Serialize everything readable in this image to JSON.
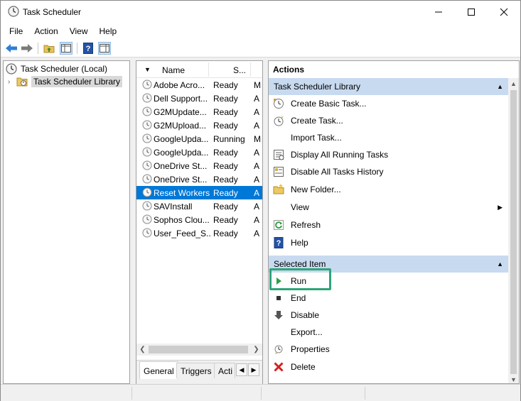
{
  "window": {
    "title": "Task Scheduler"
  },
  "menu": [
    "File",
    "Action",
    "View",
    "Help"
  ],
  "tree": {
    "root": "Task Scheduler (Local)",
    "library": "Task Scheduler Library"
  },
  "list": {
    "col_name": "Name",
    "col_status": "S...",
    "rows": [
      {
        "name": "Adobe Acro...",
        "status": "Ready",
        "trig": "M"
      },
      {
        "name": "Dell Support...",
        "status": "Ready",
        "trig": "A"
      },
      {
        "name": "G2MUpdate...",
        "status": "Ready",
        "trig": "A"
      },
      {
        "name": "G2MUpload...",
        "status": "Ready",
        "trig": "A"
      },
      {
        "name": "GoogleUpda...",
        "status": "Running",
        "trig": "M"
      },
      {
        "name": "GoogleUpda...",
        "status": "Ready",
        "trig": "A"
      },
      {
        "name": "OneDrive St...",
        "status": "Ready",
        "trig": "A"
      },
      {
        "name": "OneDrive St...",
        "status": "Ready",
        "trig": "A"
      },
      {
        "name": "Reset Workers",
        "status": "Ready",
        "trig": "A"
      },
      {
        "name": "SAVInstall",
        "status": "Ready",
        "trig": "A"
      },
      {
        "name": "Sophos Clou...",
        "status": "Ready",
        "trig": "A"
      },
      {
        "name": "User_Feed_S...",
        "status": "Ready",
        "trig": "A"
      }
    ],
    "selected_index": 8,
    "tabs": [
      "General",
      "Triggers",
      "Acti"
    ]
  },
  "actions": {
    "title": "Actions",
    "library_group": "Task Scheduler Library",
    "library_items": [
      {
        "label": "Create Basic Task...",
        "icon": "create-basic-task-icon"
      },
      {
        "label": "Create Task...",
        "icon": "create-task-icon"
      },
      {
        "label": "Import Task...",
        "icon": ""
      },
      {
        "label": "Display All Running Tasks",
        "icon": "running-tasks-icon"
      },
      {
        "label": "Disable All Tasks History",
        "icon": "history-icon"
      },
      {
        "label": "New Folder...",
        "icon": "new-folder-icon"
      },
      {
        "label": "View",
        "icon": ""
      },
      {
        "label": "Refresh",
        "icon": "refresh-icon"
      },
      {
        "label": "Help",
        "icon": "help-icon"
      }
    ],
    "selected_group": "Selected Item",
    "selected_items": [
      {
        "label": "Run",
        "icon": "run-icon"
      },
      {
        "label": "End",
        "icon": "end-icon"
      },
      {
        "label": "Disable",
        "icon": "disable-icon"
      },
      {
        "label": "Export...",
        "icon": ""
      },
      {
        "label": "Properties",
        "icon": "properties-icon"
      },
      {
        "label": "Delete",
        "icon": "delete-icon"
      }
    ]
  },
  "colors": {
    "selection": "#0078d7",
    "group_header": "#c8daf0",
    "highlight": "#2fa47a"
  }
}
